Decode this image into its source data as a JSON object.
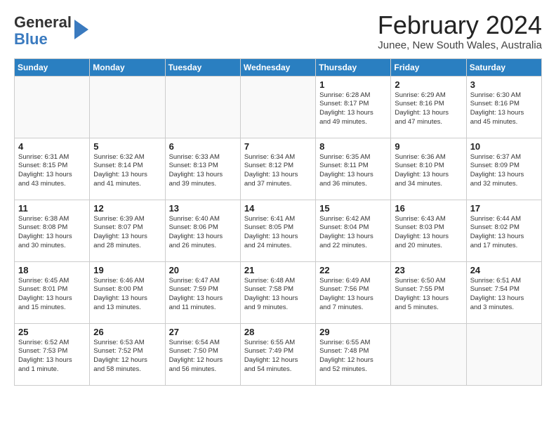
{
  "header": {
    "logo_line1": "General",
    "logo_line2": "Blue",
    "month": "February 2024",
    "location": "Junee, New South Wales, Australia"
  },
  "days_of_week": [
    "Sunday",
    "Monday",
    "Tuesday",
    "Wednesday",
    "Thursday",
    "Friday",
    "Saturday"
  ],
  "weeks": [
    [
      {
        "day": "",
        "info": ""
      },
      {
        "day": "",
        "info": ""
      },
      {
        "day": "",
        "info": ""
      },
      {
        "day": "",
        "info": ""
      },
      {
        "day": "1",
        "info": "Sunrise: 6:28 AM\nSunset: 8:17 PM\nDaylight: 13 hours\nand 49 minutes."
      },
      {
        "day": "2",
        "info": "Sunrise: 6:29 AM\nSunset: 8:16 PM\nDaylight: 13 hours\nand 47 minutes."
      },
      {
        "day": "3",
        "info": "Sunrise: 6:30 AM\nSunset: 8:16 PM\nDaylight: 13 hours\nand 45 minutes."
      }
    ],
    [
      {
        "day": "4",
        "info": "Sunrise: 6:31 AM\nSunset: 8:15 PM\nDaylight: 13 hours\nand 43 minutes."
      },
      {
        "day": "5",
        "info": "Sunrise: 6:32 AM\nSunset: 8:14 PM\nDaylight: 13 hours\nand 41 minutes."
      },
      {
        "day": "6",
        "info": "Sunrise: 6:33 AM\nSunset: 8:13 PM\nDaylight: 13 hours\nand 39 minutes."
      },
      {
        "day": "7",
        "info": "Sunrise: 6:34 AM\nSunset: 8:12 PM\nDaylight: 13 hours\nand 37 minutes."
      },
      {
        "day": "8",
        "info": "Sunrise: 6:35 AM\nSunset: 8:11 PM\nDaylight: 13 hours\nand 36 minutes."
      },
      {
        "day": "9",
        "info": "Sunrise: 6:36 AM\nSunset: 8:10 PM\nDaylight: 13 hours\nand 34 minutes."
      },
      {
        "day": "10",
        "info": "Sunrise: 6:37 AM\nSunset: 8:09 PM\nDaylight: 13 hours\nand 32 minutes."
      }
    ],
    [
      {
        "day": "11",
        "info": "Sunrise: 6:38 AM\nSunset: 8:08 PM\nDaylight: 13 hours\nand 30 minutes."
      },
      {
        "day": "12",
        "info": "Sunrise: 6:39 AM\nSunset: 8:07 PM\nDaylight: 13 hours\nand 28 minutes."
      },
      {
        "day": "13",
        "info": "Sunrise: 6:40 AM\nSunset: 8:06 PM\nDaylight: 13 hours\nand 26 minutes."
      },
      {
        "day": "14",
        "info": "Sunrise: 6:41 AM\nSunset: 8:05 PM\nDaylight: 13 hours\nand 24 minutes."
      },
      {
        "day": "15",
        "info": "Sunrise: 6:42 AM\nSunset: 8:04 PM\nDaylight: 13 hours\nand 22 minutes."
      },
      {
        "day": "16",
        "info": "Sunrise: 6:43 AM\nSunset: 8:03 PM\nDaylight: 13 hours\nand 20 minutes."
      },
      {
        "day": "17",
        "info": "Sunrise: 6:44 AM\nSunset: 8:02 PM\nDaylight: 13 hours\nand 17 minutes."
      }
    ],
    [
      {
        "day": "18",
        "info": "Sunrise: 6:45 AM\nSunset: 8:01 PM\nDaylight: 13 hours\nand 15 minutes."
      },
      {
        "day": "19",
        "info": "Sunrise: 6:46 AM\nSunset: 8:00 PM\nDaylight: 13 hours\nand 13 minutes."
      },
      {
        "day": "20",
        "info": "Sunrise: 6:47 AM\nSunset: 7:59 PM\nDaylight: 13 hours\nand 11 minutes."
      },
      {
        "day": "21",
        "info": "Sunrise: 6:48 AM\nSunset: 7:58 PM\nDaylight: 13 hours\nand 9 minutes."
      },
      {
        "day": "22",
        "info": "Sunrise: 6:49 AM\nSunset: 7:56 PM\nDaylight: 13 hours\nand 7 minutes."
      },
      {
        "day": "23",
        "info": "Sunrise: 6:50 AM\nSunset: 7:55 PM\nDaylight: 13 hours\nand 5 minutes."
      },
      {
        "day": "24",
        "info": "Sunrise: 6:51 AM\nSunset: 7:54 PM\nDaylight: 13 hours\nand 3 minutes."
      }
    ],
    [
      {
        "day": "25",
        "info": "Sunrise: 6:52 AM\nSunset: 7:53 PM\nDaylight: 13 hours\nand 1 minute."
      },
      {
        "day": "26",
        "info": "Sunrise: 6:53 AM\nSunset: 7:52 PM\nDaylight: 12 hours\nand 58 minutes."
      },
      {
        "day": "27",
        "info": "Sunrise: 6:54 AM\nSunset: 7:50 PM\nDaylight: 12 hours\nand 56 minutes."
      },
      {
        "day": "28",
        "info": "Sunrise: 6:55 AM\nSunset: 7:49 PM\nDaylight: 12 hours\nand 54 minutes."
      },
      {
        "day": "29",
        "info": "Sunrise: 6:55 AM\nSunset: 7:48 PM\nDaylight: 12 hours\nand 52 minutes."
      },
      {
        "day": "",
        "info": ""
      },
      {
        "day": "",
        "info": ""
      }
    ]
  ]
}
